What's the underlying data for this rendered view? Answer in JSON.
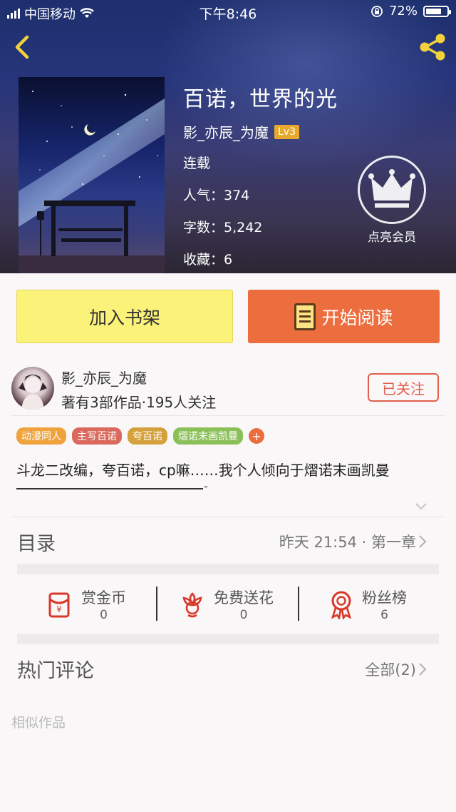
{
  "status_bar": {
    "carrier": "中国移动",
    "time": "下午8:46",
    "battery": "72%"
  },
  "book": {
    "title": "百诺，世界的光",
    "author": "影_亦辰_为魔",
    "level": "Lv3",
    "status": "连载",
    "popularity": "人气：374",
    "word_count": "字数：5,242",
    "favorites": "收藏：6"
  },
  "vip": {
    "label": "点亮会员"
  },
  "actions": {
    "add_shelf": "加入书架",
    "start_read": "开始阅读"
  },
  "author_card": {
    "name": "影_亦辰_为魔",
    "stats": "著有3部作品·195人关注",
    "follow_label": "已关注"
  },
  "tags": [
    {
      "label": "动漫同人",
      "color": "#f0a33c"
    },
    {
      "label": "主写百诺",
      "color": "#d9695d"
    },
    {
      "label": "夸百诺",
      "color": "#d4a13c"
    },
    {
      "label": "熠诺末画凯曼",
      "color": "#8bbf58"
    }
  ],
  "tag_more": "+",
  "description": "斗龙二改编，夸百诺，cp嘛……我个人倾向于熠诺末画凯曼",
  "description_tail": "-",
  "toc": {
    "label": "目录",
    "latest": "昨天 21:54 · 第一章"
  },
  "stats": [
    {
      "label": "赏金币",
      "value": "0",
      "icon": "red-envelope-icon"
    },
    {
      "label": "免费送花",
      "value": "0",
      "icon": "flower-icon"
    },
    {
      "label": "粉丝榜",
      "value": "6",
      "icon": "medal-icon"
    }
  ],
  "comments": {
    "label": "热门评论",
    "all_label": "全部(2)"
  },
  "similar": {
    "label": "相似作品"
  },
  "colors": {
    "accent": "#ec6d3e",
    "shelf_button": "#fbf27a",
    "follow": "#e25f4c",
    "level_badge": "#e8a92a"
  }
}
